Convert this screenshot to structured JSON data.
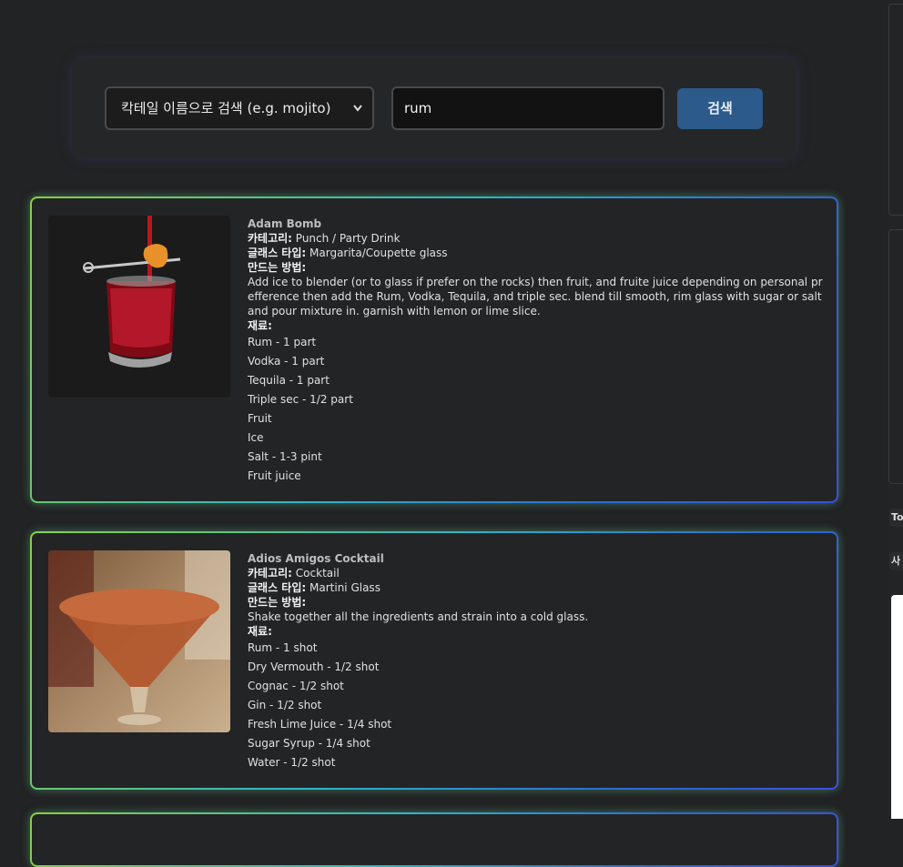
{
  "search": {
    "mode_label": "칵테일 이름으로 검색 (e.g. mojito)",
    "query": "rum",
    "button_label": "검색"
  },
  "labels": {
    "category": "카테고리:",
    "glass": "글래스 타입:",
    "instructions": "만드는 방법:",
    "ingredients": "재료:"
  },
  "cocktails": [
    {
      "name": "Adam Bomb",
      "category": "Punch / Party Drink",
      "glass": "Margarita/Coupette glass",
      "instructions": "Add ice to blender (or to glass if prefer on the rocks) then fruit, and fruite juice depending on personal prefference then add the Rum, Vodka, Tequila, and triple sec. blend till smooth, rim glass with sugar or salt and pour mixture in. garnish with lemon or lime slice.",
      "ingredients": [
        "Rum - 1 part",
        "Vodka - 1 part",
        "Tequila - 1 part",
        "Triple sec - 1/2 part",
        "Fruit",
        "Ice",
        "Salt - 1-3 pint",
        "Fruit juice"
      ]
    },
    {
      "name": "Adios Amigos Cocktail",
      "category": "Cocktail",
      "glass": "Martini Glass",
      "instructions": "Shake together all the ingredients and strain into a cold glass.",
      "ingredients": [
        "Rum - 1 shot",
        "Dry Vermouth - 1/2 shot",
        "Cognac - 1/2 shot",
        "Gin - 1/2 shot",
        "Fresh Lime Juice - 1/4 shot",
        "Sugar Syrup - 1/4 shot",
        "Water - 1/2 shot"
      ]
    }
  ],
  "side": {
    "tab1": "To",
    "tab2": "사"
  },
  "colors": {
    "background": "#222324",
    "button": "#2b5a8b",
    "border_glow_start": "#8bd13a",
    "border_glow_end": "#3a4fe0"
  }
}
